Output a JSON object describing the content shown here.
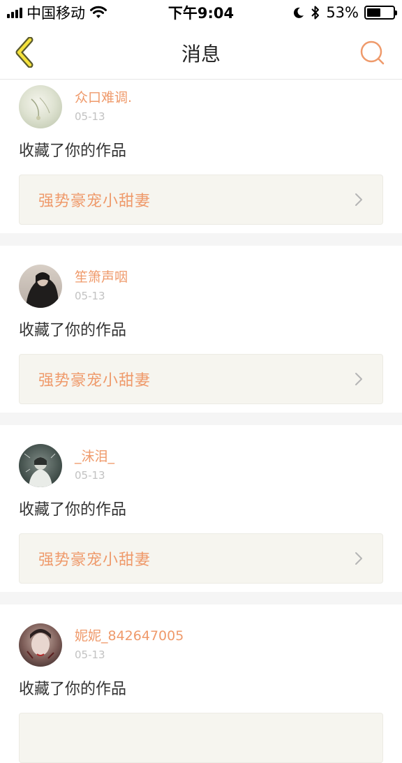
{
  "status_bar": {
    "carrier": "中国移动",
    "time": "下午9:04",
    "battery_percent": "53%",
    "battery_level": 0.53
  },
  "nav": {
    "title": "消息",
    "accent_color": "#ef9a6b"
  },
  "notifications": [
    {
      "user": "众口难调.",
      "date": "05-13",
      "action": "收藏了你的作品",
      "work_title": "强势豪宠小甜妻"
    },
    {
      "user": "笙箫声咽",
      "date": "05-13",
      "action": "收藏了你的作品",
      "work_title": "强势豪宠小甜妻"
    },
    {
      "user": "_沫泪_",
      "date": "05-13",
      "action": "收藏了你的作品",
      "work_title": "强势豪宠小甜妻"
    },
    {
      "user": "妮妮_842647005",
      "date": "05-13",
      "action": "收藏了你的作品",
      "work_title": ""
    }
  ]
}
